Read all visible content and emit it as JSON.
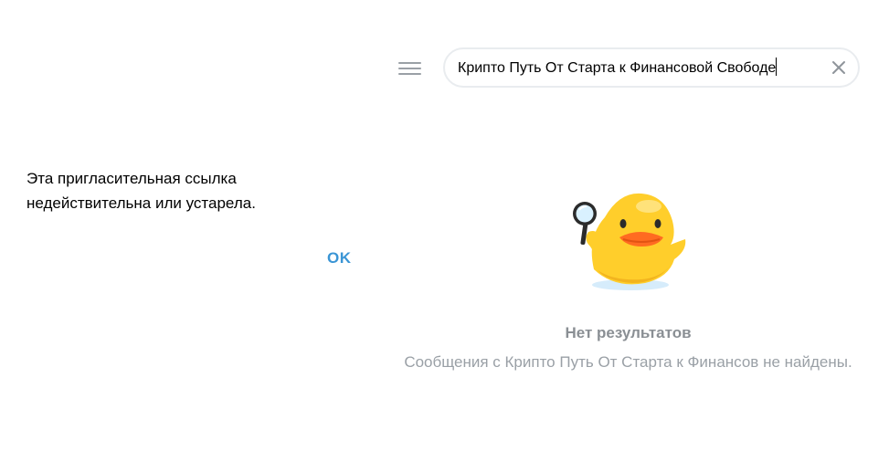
{
  "dialog": {
    "message_line1": "Эта пригласительная ссылка",
    "message_line2": "недействительна или устарела.",
    "ok_label": "OK"
  },
  "search": {
    "value": "Крипто Путь От Старта к Финансовой Свободе"
  },
  "icons": {
    "menu": "hamburger-menu-icon",
    "clear": "close-icon",
    "sticker": "duck-magnifier-sticker"
  },
  "results": {
    "title": "Нет результатов",
    "subtitle": "Сообщения с Крипто Путь От Старта к Финансов не найдены."
  },
  "colors": {
    "accent": "#3a95d5",
    "muted_text": "#9aa0a6",
    "duck_yellow": "#ffce2b",
    "duck_beak": "#ff6b21"
  }
}
